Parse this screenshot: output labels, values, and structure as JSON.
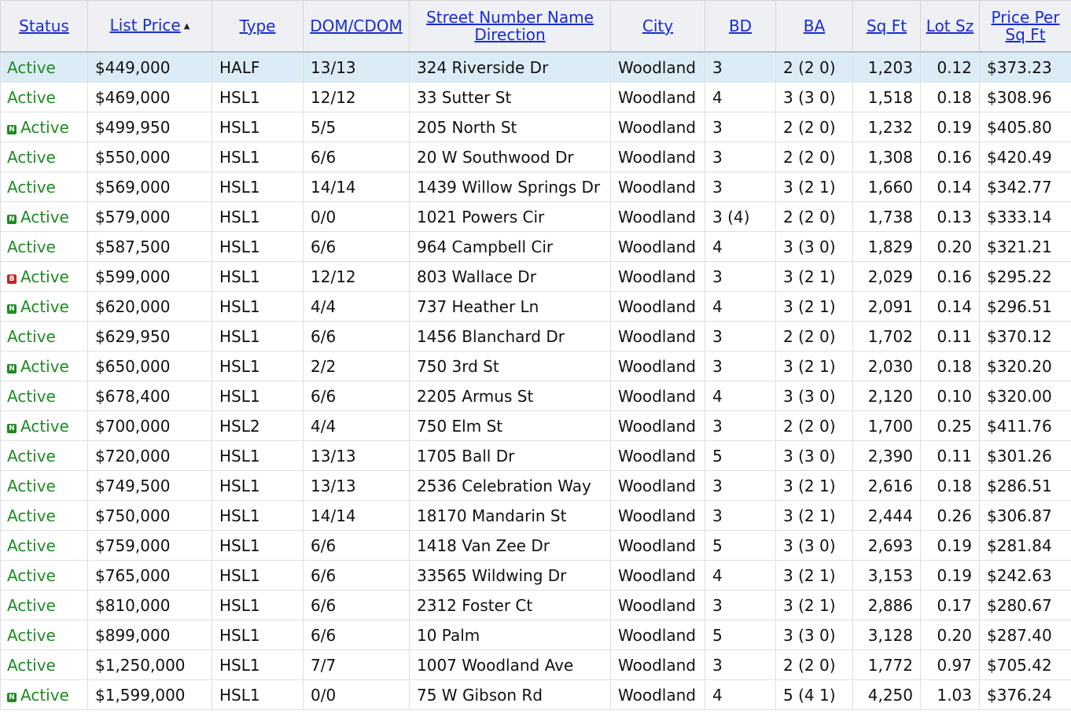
{
  "colors": {
    "link": "#1a2ccf",
    "status_active": "#1f8a23",
    "selected_row": "#dcecf7",
    "header_bg": "#eef0f4",
    "flag_new": "#1f8a23",
    "flag_back": "#c3262a"
  },
  "columns": [
    {
      "label": "Status"
    },
    {
      "label": "List Price",
      "sort": "ascending",
      "sort_icon": "sort-up-icon"
    },
    {
      "label": "Type"
    },
    {
      "label": "DOM/CDOM"
    },
    {
      "label": "Street Number Name Direction"
    },
    {
      "label": "City"
    },
    {
      "label": "BD"
    },
    {
      "label": "BA"
    },
    {
      "label": "Sq Ft"
    },
    {
      "label": "Lot Sz"
    },
    {
      "label": "Price Per Sq Ft"
    }
  ],
  "rows": [
    {
      "flag": "",
      "status": "Active",
      "price": "$449,000",
      "type": "HALF",
      "dom": "13/13",
      "address": "324 Riverside Dr",
      "city": "Woodland",
      "bd": "3",
      "ba": "2 (2 0)",
      "sqft": "1,203",
      "lot": "0.12",
      "ppsf": "$373.23",
      "selected": true
    },
    {
      "flag": "",
      "status": "Active",
      "price": "$469,000",
      "type": "HSL1",
      "dom": "12/12",
      "address": "33 Sutter St",
      "city": "Woodland",
      "bd": "4",
      "ba": "3 (3 0)",
      "sqft": "1,518",
      "lot": "0.18",
      "ppsf": "$308.96"
    },
    {
      "flag": "N",
      "status": "Active",
      "price": "$499,950",
      "type": "HSL1",
      "dom": "5/5",
      "address": "205 North St",
      "city": "Woodland",
      "bd": "3",
      "ba": "2 (2 0)",
      "sqft": "1,232",
      "lot": "0.19",
      "ppsf": "$405.80"
    },
    {
      "flag": "",
      "status": "Active",
      "price": "$550,000",
      "type": "HSL1",
      "dom": "6/6",
      "address": "20 W Southwood Dr",
      "city": "Woodland",
      "bd": "3",
      "ba": "2 (2 0)",
      "sqft": "1,308",
      "lot": "0.16",
      "ppsf": "$420.49"
    },
    {
      "flag": "",
      "status": "Active",
      "price": "$569,000",
      "type": "HSL1",
      "dom": "14/14",
      "address": "1439 Willow Springs Dr",
      "city": "Woodland",
      "bd": "3",
      "ba": "3 (2 1)",
      "sqft": "1,660",
      "lot": "0.14",
      "ppsf": "$342.77"
    },
    {
      "flag": "N",
      "status": "Active",
      "price": "$579,000",
      "type": "HSL1",
      "dom": "0/0",
      "address": "1021 Powers Cir",
      "city": "Woodland",
      "bd": "3 (4)",
      "ba": "2 (2 0)",
      "sqft": "1,738",
      "lot": "0.13",
      "ppsf": "$333.14"
    },
    {
      "flag": "",
      "status": "Active",
      "price": "$587,500",
      "type": "HSL1",
      "dom": "6/6",
      "address": "964 Campbell Cir",
      "city": "Woodland",
      "bd": "4",
      "ba": "3 (3 0)",
      "sqft": "1,829",
      "lot": "0.20",
      "ppsf": "$321.21"
    },
    {
      "flag": "B",
      "status": "Active",
      "price": "$599,000",
      "type": "HSL1",
      "dom": "12/12",
      "address": "803 Wallace Dr",
      "city": "Woodland",
      "bd": "3",
      "ba": "3 (2 1)",
      "sqft": "2,029",
      "lot": "0.16",
      "ppsf": "$295.22"
    },
    {
      "flag": "N",
      "status": "Active",
      "price": "$620,000",
      "type": "HSL1",
      "dom": "4/4",
      "address": "737 Heather Ln",
      "city": "Woodland",
      "bd": "4",
      "ba": "3 (2 1)",
      "sqft": "2,091",
      "lot": "0.14",
      "ppsf": "$296.51"
    },
    {
      "flag": "",
      "status": "Active",
      "price": "$629,950",
      "type": "HSL1",
      "dom": "6/6",
      "address": "1456 Blanchard Dr",
      "city": "Woodland",
      "bd": "3",
      "ba": "2 (2 0)",
      "sqft": "1,702",
      "lot": "0.11",
      "ppsf": "$370.12"
    },
    {
      "flag": "N",
      "status": "Active",
      "price": "$650,000",
      "type": "HSL1",
      "dom": "2/2",
      "address": "750 3rd St",
      "city": "Woodland",
      "bd": "3",
      "ba": "3 (2 1)",
      "sqft": "2,030",
      "lot": "0.18",
      "ppsf": "$320.20"
    },
    {
      "flag": "",
      "status": "Active",
      "price": "$678,400",
      "type": "HSL1",
      "dom": "6/6",
      "address": "2205 Armus St",
      "city": "Woodland",
      "bd": "4",
      "ba": "3 (3 0)",
      "sqft": "2,120",
      "lot": "0.10",
      "ppsf": "$320.00"
    },
    {
      "flag": "N",
      "status": "Active",
      "price": "$700,000",
      "type": "HSL2",
      "dom": "4/4",
      "address": "750 Elm St",
      "city": "Woodland",
      "bd": "3",
      "ba": "2 (2 0)",
      "sqft": "1,700",
      "lot": "0.25",
      "ppsf": "$411.76"
    },
    {
      "flag": "",
      "status": "Active",
      "price": "$720,000",
      "type": "HSL1",
      "dom": "13/13",
      "address": "1705 Ball Dr",
      "city": "Woodland",
      "bd": "5",
      "ba": "3 (3 0)",
      "sqft": "2,390",
      "lot": "0.11",
      "ppsf": "$301.26"
    },
    {
      "flag": "",
      "status": "Active",
      "price": "$749,500",
      "type": "HSL1",
      "dom": "13/13",
      "address": "2536 Celebration Way",
      "city": "Woodland",
      "bd": "3",
      "ba": "3 (2 1)",
      "sqft": "2,616",
      "lot": "0.18",
      "ppsf": "$286.51"
    },
    {
      "flag": "",
      "status": "Active",
      "price": "$750,000",
      "type": "HSL1",
      "dom": "14/14",
      "address": "18170 Mandarin St",
      "city": "Woodland",
      "bd": "3",
      "ba": "3 (2 1)",
      "sqft": "2,444",
      "lot": "0.26",
      "ppsf": "$306.87"
    },
    {
      "flag": "",
      "status": "Active",
      "price": "$759,000",
      "type": "HSL1",
      "dom": "6/6",
      "address": "1418 Van Zee Dr",
      "city": "Woodland",
      "bd": "5",
      "ba": "3 (3 0)",
      "sqft": "2,693",
      "lot": "0.19",
      "ppsf": "$281.84"
    },
    {
      "flag": "",
      "status": "Active",
      "price": "$765,000",
      "type": "HSL1",
      "dom": "6/6",
      "address": "33565 Wildwing Dr",
      "city": "Woodland",
      "bd": "4",
      "ba": "3 (2 1)",
      "sqft": "3,153",
      "lot": "0.19",
      "ppsf": "$242.63"
    },
    {
      "flag": "",
      "status": "Active",
      "price": "$810,000",
      "type": "HSL1",
      "dom": "6/6",
      "address": "2312 Foster Ct",
      "city": "Woodland",
      "bd": "3",
      "ba": "3 (2 1)",
      "sqft": "2,886",
      "lot": "0.17",
      "ppsf": "$280.67"
    },
    {
      "flag": "",
      "status": "Active",
      "price": "$899,000",
      "type": "HSL1",
      "dom": "6/6",
      "address": "10 Palm",
      "city": "Woodland",
      "bd": "5",
      "ba": "3 (3 0)",
      "sqft": "3,128",
      "lot": "0.20",
      "ppsf": "$287.40"
    },
    {
      "flag": "",
      "status": "Active",
      "price": "$1,250,000",
      "type": "HSL1",
      "dom": "7/7",
      "address": "1007 Woodland Ave",
      "city": "Woodland",
      "bd": "3",
      "ba": "2 (2 0)",
      "sqft": "1,772",
      "lot": "0.97",
      "ppsf": "$705.42"
    },
    {
      "flag": "N",
      "status": "Active",
      "price": "$1,599,000",
      "type": "HSL1",
      "dom": "0/0",
      "address": "75 W Gibson Rd",
      "city": "Woodland",
      "bd": "4",
      "ba": "5 (4 1)",
      "sqft": "4,250",
      "lot": "1.03",
      "ppsf": "$376.24"
    }
  ]
}
